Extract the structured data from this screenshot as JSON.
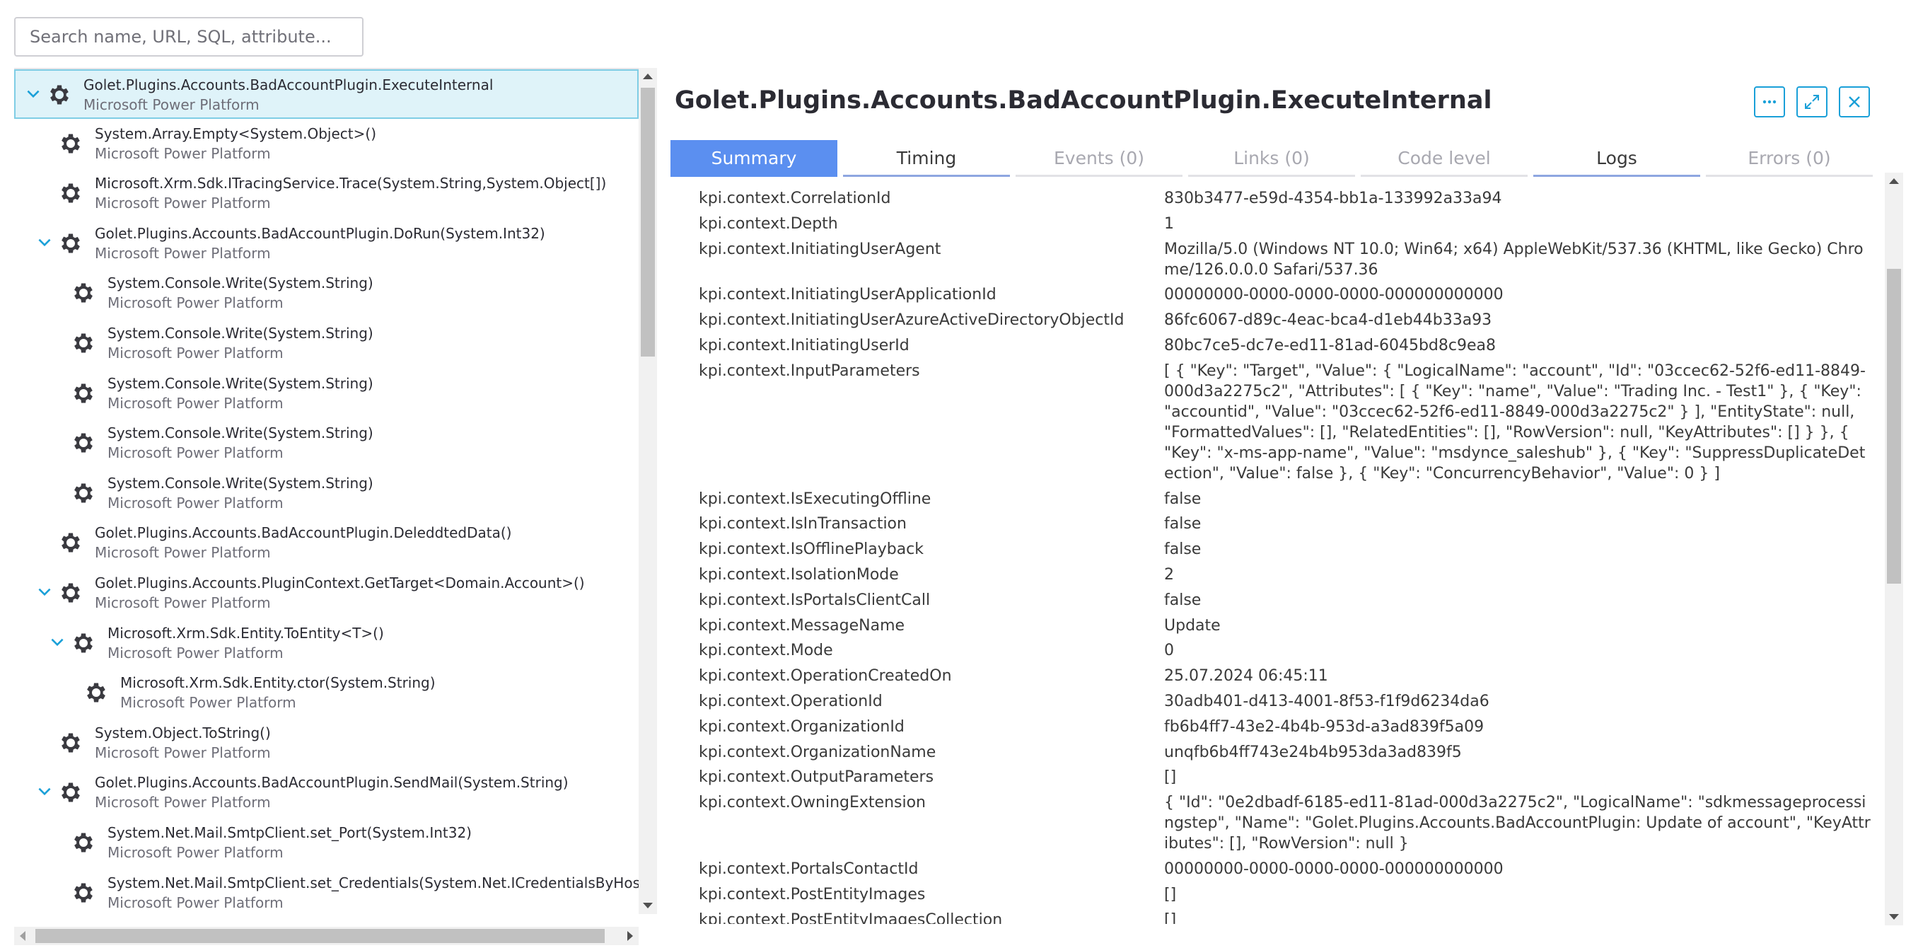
{
  "search": {
    "placeholder": "Search name, URL, SQL, attribute..."
  },
  "tree": [
    {
      "name": "Golet.Plugins.Accounts.BadAccountPlugin.ExecuteInternal",
      "sub": "Microsoft Power Platform",
      "depth": 0,
      "expand": true,
      "selected": true
    },
    {
      "name": "System.Array.Empty<System.Object>()",
      "sub": "Microsoft Power Platform",
      "depth": 1,
      "expand": false
    },
    {
      "name": "Microsoft.Xrm.Sdk.ITracingService.Trace(System.String,System.Object[])",
      "sub": "Microsoft Power Platform",
      "depth": 1,
      "expand": false
    },
    {
      "name": "Golet.Plugins.Accounts.BadAccountPlugin.DoRun(System.Int32)",
      "sub": "Microsoft Power Platform",
      "depth": 1,
      "expand": true
    },
    {
      "name": "System.Console.Write(System.String)",
      "sub": "Microsoft Power Platform",
      "depth": 2,
      "expand": false
    },
    {
      "name": "System.Console.Write(System.String)",
      "sub": "Microsoft Power Platform",
      "depth": 2,
      "expand": false
    },
    {
      "name": "System.Console.Write(System.String)",
      "sub": "Microsoft Power Platform",
      "depth": 2,
      "expand": false
    },
    {
      "name": "System.Console.Write(System.String)",
      "sub": "Microsoft Power Platform",
      "depth": 2,
      "expand": false
    },
    {
      "name": "System.Console.Write(System.String)",
      "sub": "Microsoft Power Platform",
      "depth": 2,
      "expand": false
    },
    {
      "name": "Golet.Plugins.Accounts.BadAccountPlugin.DeleddtedData()",
      "sub": "Microsoft Power Platform",
      "depth": 1,
      "expand": false
    },
    {
      "name": "Golet.Plugins.Accounts.PluginContext.GetTarget<Domain.Account>()",
      "sub": "Microsoft Power Platform",
      "depth": 1,
      "expand": true
    },
    {
      "name": "Microsoft.Xrm.Sdk.Entity.ToEntity<T>()",
      "sub": "Microsoft Power Platform",
      "depth": 2,
      "expand": true
    },
    {
      "name": "Microsoft.Xrm.Sdk.Entity.ctor(System.String)",
      "sub": "Microsoft Power Platform",
      "depth": 3,
      "expand": false
    },
    {
      "name": "System.Object.ToString()",
      "sub": "Microsoft Power Platform",
      "depth": 1,
      "expand": false
    },
    {
      "name": "Golet.Plugins.Accounts.BadAccountPlugin.SendMail(System.String)",
      "sub": "Microsoft Power Platform",
      "depth": 1,
      "expand": true
    },
    {
      "name": "System.Net.Mail.SmtpClient.set_Port(System.Int32)",
      "sub": "Microsoft Power Platform",
      "depth": 2,
      "expand": false
    },
    {
      "name": "System.Net.Mail.SmtpClient.set_Credentials(System.Net.ICredentialsByHost)",
      "sub": "Microsoft Power Platform",
      "depth": 2,
      "expand": false
    }
  ],
  "detail": {
    "title": "Golet.Plugins.Accounts.BadAccountPlugin.ExecuteInternal",
    "tabs": [
      {
        "label": "Summary",
        "state": "active"
      },
      {
        "label": "Timing",
        "state": "enabled"
      },
      {
        "label": "Events (0)",
        "state": "disabled"
      },
      {
        "label": "Links (0)",
        "state": "disabled"
      },
      {
        "label": "Code level",
        "state": "disabled"
      },
      {
        "label": "Logs",
        "state": "enabled"
      },
      {
        "label": "Errors (0)",
        "state": "disabled"
      }
    ],
    "properties": [
      {
        "key": "kpi.context.CorrelationId",
        "value": "830b3477-e59d-4354-bb1a-133992a33a94"
      },
      {
        "key": "kpi.context.Depth",
        "value": "1"
      },
      {
        "key": "kpi.context.InitiatingUserAgent",
        "value": "Mozilla/5.0 (Windows NT 10.0; Win64; x64) AppleWebKit/537.36 (KHTML, like Gecko) Chrome/126.0.0.0 Safari/537.36"
      },
      {
        "key": "kpi.context.InitiatingUserApplicationId",
        "value": "00000000-0000-0000-0000-000000000000"
      },
      {
        "key": "kpi.context.InitiatingUserAzureActiveDirectoryObjectId",
        "value": "86fc6067-d89c-4eac-bca4-d1eb44b33a93"
      },
      {
        "key": "kpi.context.InitiatingUserId",
        "value": "80bc7ce5-dc7e-ed11-81ad-6045bd8c9ea8"
      },
      {
        "key": "kpi.context.InputParameters",
        "value": "[ { \"Key\": \"Target\", \"Value\": { \"LogicalName\": \"account\", \"Id\": \"03ccec62-52f6-ed11-8849-000d3a2275c2\", \"Attributes\": [ { \"Key\": \"name\", \"Value\": \"Trading Inc. - Test1\" }, { \"Key\": \"accountid\", \"Value\": \"03ccec62-52f6-ed11-8849-000d3a2275c2\" } ], \"EntityState\": null, \"FormattedValues\": [], \"RelatedEntities\": [], \"RowVersion\": null, \"KeyAttributes\": [] } }, { \"Key\": \"x-ms-app-name\", \"Value\": \"msdynce_saleshub\" }, { \"Key\": \"SuppressDuplicateDetection\", \"Value\": false }, { \"Key\": \"ConcurrencyBehavior\", \"Value\": 0 } ]"
      },
      {
        "key": "kpi.context.IsExecutingOffline",
        "value": "false"
      },
      {
        "key": "kpi.context.IsInTransaction",
        "value": "false"
      },
      {
        "key": "kpi.context.IsOfflinePlayback",
        "value": "false"
      },
      {
        "key": "kpi.context.IsolationMode",
        "value": "2"
      },
      {
        "key": "kpi.context.IsPortalsClientCall",
        "value": "false"
      },
      {
        "key": "kpi.context.MessageName",
        "value": "Update"
      },
      {
        "key": "kpi.context.Mode",
        "value": "0"
      },
      {
        "key": "kpi.context.OperationCreatedOn",
        "value": "25.07.2024 06:45:11"
      },
      {
        "key": "kpi.context.OperationId",
        "value": "30adb401-d413-4001-8f53-f1f9d6234da6"
      },
      {
        "key": "kpi.context.OrganizationId",
        "value": "fb6b4ff7-43e2-4b4b-953d-a3ad839f5a09"
      },
      {
        "key": "kpi.context.OrganizationName",
        "value": "unqfb6b4ff743e24b4b953da3ad839f5"
      },
      {
        "key": "kpi.context.OutputParameters",
        "value": "[]"
      },
      {
        "key": "kpi.context.OwningExtension",
        "value": "{ \"Id\": \"0e2dbadf-6185-ed11-81ad-000d3a2275c2\", \"LogicalName\": \"sdkmessageprocessingstep\", \"Name\": \"Golet.Plugins.Accounts.BadAccountPlugin: Update of account\", \"KeyAttributes\": [], \"RowVersion\": null }"
      },
      {
        "key": "kpi.context.PortalsContactId",
        "value": "00000000-0000-0000-0000-000000000000"
      },
      {
        "key": "kpi.context.PostEntityImages",
        "value": "[]"
      },
      {
        "key": "kpi.context.PostEntityImagesCollection",
        "value": "[]"
      }
    ]
  },
  "colors": {
    "accent": "#1aa0d8",
    "tab_active": "#5b8ff0",
    "selected_bg": "#dff3f9"
  },
  "icons": {
    "tree_node": "gear-icon",
    "expand": "chevron-down-icon",
    "more": "more-icon",
    "expand_view": "expand-icon",
    "close": "close-icon"
  }
}
